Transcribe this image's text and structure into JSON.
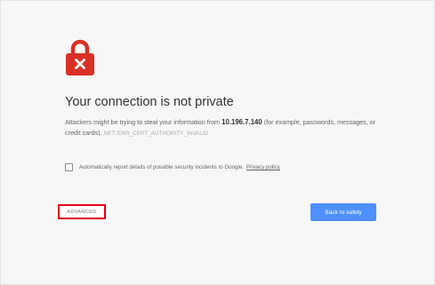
{
  "error_page": {
    "icon": "lock-error-icon",
    "headline": "Your connection is not private",
    "message_before_host": "Attackers might be trying to steal your information from ",
    "host": "10.196.7.140",
    "message_after_host": " (for example, passwords, messages, or credit cards). ",
    "error_code": "NET::ERR_CERT_AUTHORITY_INVALID",
    "optin_text": "Automatically report details of possible security incidents to Google.",
    "privacy_link": "Privacy policy",
    "advanced_label": "ADVANCED",
    "back_label": "Back to safety"
  },
  "colors": {
    "lock": "#d93025",
    "highlight_border": "#e0001b",
    "primary_button": "#4d90fe"
  }
}
